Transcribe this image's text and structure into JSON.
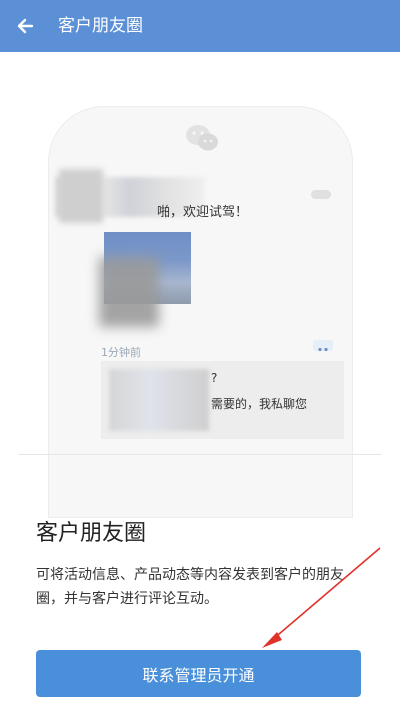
{
  "header": {
    "back_icon": "arrow-left-icon",
    "title": "客户朋友圈"
  },
  "preview": {
    "wechat_icon": "wechat-chat-bubbles-icon",
    "post_text_visible": "啪，欢迎试驾！",
    "post_time": "1分钟前",
    "comment_line1": "?",
    "comment_line2": "需要的，我私聊您"
  },
  "feature": {
    "title": "客户朋友圈",
    "description": "可将活动信息、产品动态等内容发表到客户的朋友圈，并与客户进行评论互动。"
  },
  "actions": {
    "primary_label": "联系管理员开通"
  },
  "colors": {
    "header_bg": "#5b8fd6",
    "primary_button": "#4a8fd9",
    "annotation_arrow": "#e0312a"
  }
}
